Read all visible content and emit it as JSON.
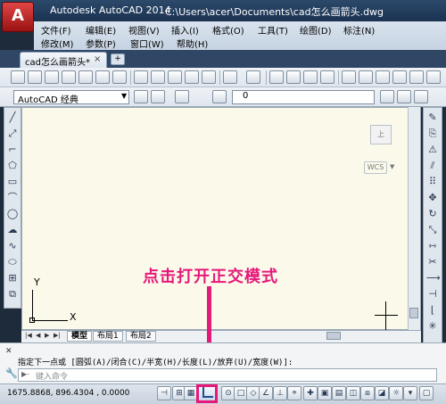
{
  "window": {
    "app_title": "Autodesk AutoCAD 2014",
    "file_path": "C:\\Users\\acer\\Documents\\cad怎么画箭头.dwg",
    "app_button": "A"
  },
  "menu": {
    "row1": [
      "文件(F)",
      "编辑(E)",
      "视图(V)",
      "插入(I)",
      "格式(O)",
      "工具(T)",
      "绘图(D)",
      "标注(N)"
    ],
    "row2": [
      "修改(M)",
      "参数(P)",
      "窗口(W)",
      "帮助(H)"
    ]
  },
  "tabs": {
    "document_tab": "cad怎么画箭头*",
    "close": "×",
    "new_tab": "+"
  },
  "toolbar": {
    "workspace": "AutoCAD 经典",
    "layer": "0"
  },
  "viewport": {
    "ucs_x": "X",
    "ucs_y": "Y",
    "viewcube_label": "上",
    "wcs_label": "WCS"
  },
  "layout_tabs": [
    "模型",
    "布局1",
    "布局2"
  ],
  "annotation": "点击打开正交模式",
  "command": {
    "history": "指定下一点或 [圆弧(A)/闭合(C)/半宽(H)/长度(L)/放弃(U)/宽度(W)]:",
    "placeholder": "键入命令"
  },
  "statusbar": {
    "coordinates": "1675.8868, 896.4304 , 0.0000",
    "ortho_mode": "on"
  },
  "colors": {
    "annotation": "#e6187a",
    "drawing_background": "#fbfaea",
    "title_bar": "#2c4a6b"
  }
}
